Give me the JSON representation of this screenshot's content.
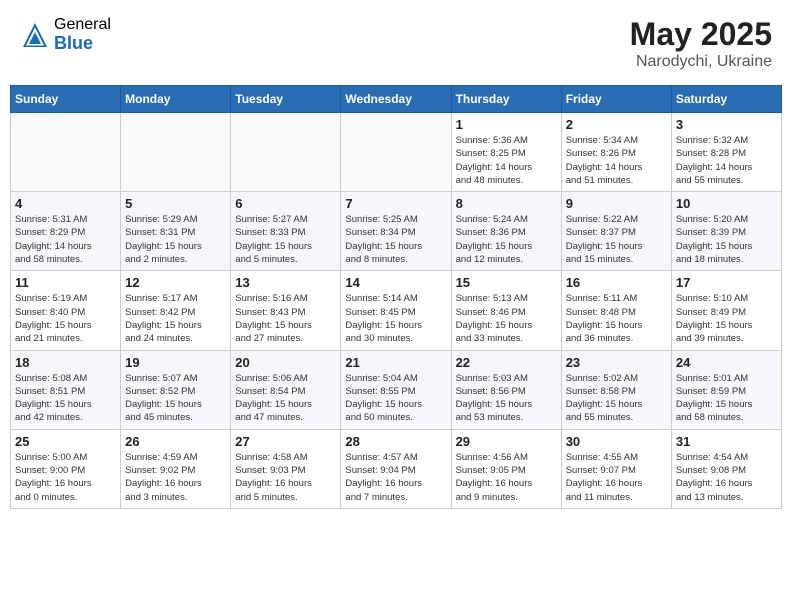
{
  "header": {
    "logo_general": "General",
    "logo_blue": "Blue",
    "month": "May 2025",
    "location": "Narodychi, Ukraine"
  },
  "weekdays": [
    "Sunday",
    "Monday",
    "Tuesday",
    "Wednesday",
    "Thursday",
    "Friday",
    "Saturday"
  ],
  "weeks": [
    [
      {
        "day": "",
        "detail": ""
      },
      {
        "day": "",
        "detail": ""
      },
      {
        "day": "",
        "detail": ""
      },
      {
        "day": "",
        "detail": ""
      },
      {
        "day": "1",
        "detail": "Sunrise: 5:36 AM\nSunset: 8:25 PM\nDaylight: 14 hours\nand 48 minutes."
      },
      {
        "day": "2",
        "detail": "Sunrise: 5:34 AM\nSunset: 8:26 PM\nDaylight: 14 hours\nand 51 minutes."
      },
      {
        "day": "3",
        "detail": "Sunrise: 5:32 AM\nSunset: 8:28 PM\nDaylight: 14 hours\nand 55 minutes."
      }
    ],
    [
      {
        "day": "4",
        "detail": "Sunrise: 5:31 AM\nSunset: 8:29 PM\nDaylight: 14 hours\nand 58 minutes."
      },
      {
        "day": "5",
        "detail": "Sunrise: 5:29 AM\nSunset: 8:31 PM\nDaylight: 15 hours\nand 2 minutes."
      },
      {
        "day": "6",
        "detail": "Sunrise: 5:27 AM\nSunset: 8:33 PM\nDaylight: 15 hours\nand 5 minutes."
      },
      {
        "day": "7",
        "detail": "Sunrise: 5:25 AM\nSunset: 8:34 PM\nDaylight: 15 hours\nand 8 minutes."
      },
      {
        "day": "8",
        "detail": "Sunrise: 5:24 AM\nSunset: 8:36 PM\nDaylight: 15 hours\nand 12 minutes."
      },
      {
        "day": "9",
        "detail": "Sunrise: 5:22 AM\nSunset: 8:37 PM\nDaylight: 15 hours\nand 15 minutes."
      },
      {
        "day": "10",
        "detail": "Sunrise: 5:20 AM\nSunset: 8:39 PM\nDaylight: 15 hours\nand 18 minutes."
      }
    ],
    [
      {
        "day": "11",
        "detail": "Sunrise: 5:19 AM\nSunset: 8:40 PM\nDaylight: 15 hours\nand 21 minutes."
      },
      {
        "day": "12",
        "detail": "Sunrise: 5:17 AM\nSunset: 8:42 PM\nDaylight: 15 hours\nand 24 minutes."
      },
      {
        "day": "13",
        "detail": "Sunrise: 5:16 AM\nSunset: 8:43 PM\nDaylight: 15 hours\nand 27 minutes."
      },
      {
        "day": "14",
        "detail": "Sunrise: 5:14 AM\nSunset: 8:45 PM\nDaylight: 15 hours\nand 30 minutes."
      },
      {
        "day": "15",
        "detail": "Sunrise: 5:13 AM\nSunset: 8:46 PM\nDaylight: 15 hours\nand 33 minutes."
      },
      {
        "day": "16",
        "detail": "Sunrise: 5:11 AM\nSunset: 8:48 PM\nDaylight: 15 hours\nand 36 minutes."
      },
      {
        "day": "17",
        "detail": "Sunrise: 5:10 AM\nSunset: 8:49 PM\nDaylight: 15 hours\nand 39 minutes."
      }
    ],
    [
      {
        "day": "18",
        "detail": "Sunrise: 5:08 AM\nSunset: 8:51 PM\nDaylight: 15 hours\nand 42 minutes."
      },
      {
        "day": "19",
        "detail": "Sunrise: 5:07 AM\nSunset: 8:52 PM\nDaylight: 15 hours\nand 45 minutes."
      },
      {
        "day": "20",
        "detail": "Sunrise: 5:06 AM\nSunset: 8:54 PM\nDaylight: 15 hours\nand 47 minutes."
      },
      {
        "day": "21",
        "detail": "Sunrise: 5:04 AM\nSunset: 8:55 PM\nDaylight: 15 hours\nand 50 minutes."
      },
      {
        "day": "22",
        "detail": "Sunrise: 5:03 AM\nSunset: 8:56 PM\nDaylight: 15 hours\nand 53 minutes."
      },
      {
        "day": "23",
        "detail": "Sunrise: 5:02 AM\nSunset: 8:58 PM\nDaylight: 15 hours\nand 55 minutes."
      },
      {
        "day": "24",
        "detail": "Sunrise: 5:01 AM\nSunset: 8:59 PM\nDaylight: 15 hours\nand 58 minutes."
      }
    ],
    [
      {
        "day": "25",
        "detail": "Sunrise: 5:00 AM\nSunset: 9:00 PM\nDaylight: 16 hours\nand 0 minutes."
      },
      {
        "day": "26",
        "detail": "Sunrise: 4:59 AM\nSunset: 9:02 PM\nDaylight: 16 hours\nand 3 minutes."
      },
      {
        "day": "27",
        "detail": "Sunrise: 4:58 AM\nSunset: 9:03 PM\nDaylight: 16 hours\nand 5 minutes."
      },
      {
        "day": "28",
        "detail": "Sunrise: 4:57 AM\nSunset: 9:04 PM\nDaylight: 16 hours\nand 7 minutes."
      },
      {
        "day": "29",
        "detail": "Sunrise: 4:56 AM\nSunset: 9:05 PM\nDaylight: 16 hours\nand 9 minutes."
      },
      {
        "day": "30",
        "detail": "Sunrise: 4:55 AM\nSunset: 9:07 PM\nDaylight: 16 hours\nand 11 minutes."
      },
      {
        "day": "31",
        "detail": "Sunrise: 4:54 AM\nSunset: 9:08 PM\nDaylight: 16 hours\nand 13 minutes."
      }
    ]
  ]
}
